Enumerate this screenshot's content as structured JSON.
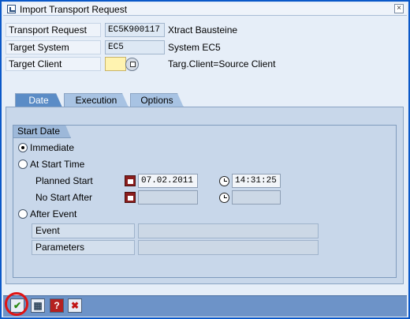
{
  "window": {
    "title": "Import Transport Request",
    "close_glyph": "×"
  },
  "header": {
    "transport_request": {
      "label": "Transport Request",
      "value": "EC5K900117",
      "description": "Xtract Bausteine"
    },
    "target_system": {
      "label": "Target System",
      "value": "EC5",
      "description": "System EC5"
    },
    "target_client": {
      "label": "Target Client",
      "value": "",
      "description": "Targ.Client=Source Client"
    }
  },
  "tabs": [
    {
      "label": "Date",
      "active": true
    },
    {
      "label": "Execution",
      "active": false
    },
    {
      "label": "Options",
      "active": false
    }
  ],
  "start_date": {
    "group_title": "Start Date",
    "options": {
      "immediate": {
        "label": "Immediate",
        "selected": true
      },
      "at_start_time": {
        "label": "At Start Time",
        "selected": false
      },
      "after_event": {
        "label": "After Event",
        "selected": false
      }
    },
    "planned_start": {
      "label": "Planned Start",
      "date": "07.02.2011",
      "time": "14:31:25"
    },
    "no_start_after": {
      "label": "No Start After",
      "date": "",
      "time": ""
    },
    "event": {
      "label": "Event",
      "value": ""
    },
    "parameters": {
      "label": "Parameters",
      "value": ""
    }
  },
  "footer": {
    "buttons": {
      "confirm": {
        "glyph": "✔",
        "icon": "checkmark-icon"
      },
      "schedule": {
        "glyph": "▦",
        "icon": "schedule-icon"
      },
      "help": {
        "glyph": "?",
        "icon": "help-icon"
      },
      "cancel": {
        "glyph": "✖",
        "icon": "cancel-icon"
      }
    }
  },
  "colors": {
    "accent": "#5b8cc6",
    "highlight": "#e01414",
    "window_border": "#0a58c8"
  }
}
